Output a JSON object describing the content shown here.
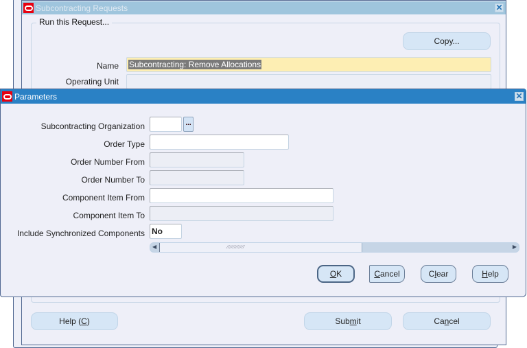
{
  "main_window": {
    "title": "Subcontracting Requests",
    "group_label": "Run this Request...",
    "copy_button": "Copy...",
    "name_label": "Name",
    "name_value": "Subcontracting: Remove Allocations",
    "operating_unit_label": "Operating Unit",
    "operating_unit_value": "",
    "help_button": {
      "pre": "Help (",
      "key": "C",
      "post": ")"
    },
    "submit_button": {
      "pre": "Sub",
      "key": "m",
      "post": "it"
    },
    "cancel_button": {
      "pre": "Ca",
      "key": "n",
      "post": "cel"
    }
  },
  "parameters_dialog": {
    "title": "Parameters",
    "fields": [
      {
        "label": "Subcontracting Organization",
        "value": "",
        "enabled": true,
        "has_lov": true
      },
      {
        "label": "Order Type",
        "value": "",
        "enabled": true
      },
      {
        "label": "Order Number From",
        "value": "",
        "enabled": false
      },
      {
        "label": "Order Number To",
        "value": "",
        "enabled": false
      },
      {
        "label": "Component Item From",
        "value": "",
        "enabled": true
      },
      {
        "label": "Component Item To",
        "value": "",
        "enabled": false
      },
      {
        "label": "Include Synchronized Components",
        "value": "No",
        "enabled": true
      }
    ],
    "lov_button": "...",
    "scrollbar_position": 0.0,
    "buttons": {
      "ok": {
        "pre": "",
        "key": "O",
        "post": "K"
      },
      "cancel": {
        "pre": "",
        "key": "C",
        "post": "ancel"
      },
      "clear": {
        "pre": "C",
        "key": "l",
        "post": "ear"
      },
      "help": {
        "pre": "",
        "key": "H",
        "post": "elp"
      }
    }
  },
  "colors": {
    "dialog_titlebar": "#2a81c5",
    "inactive_titlebar": "#9fc5dd",
    "name_field_bg": "#fdeeb3",
    "button_bg": "#d6e6f6"
  }
}
